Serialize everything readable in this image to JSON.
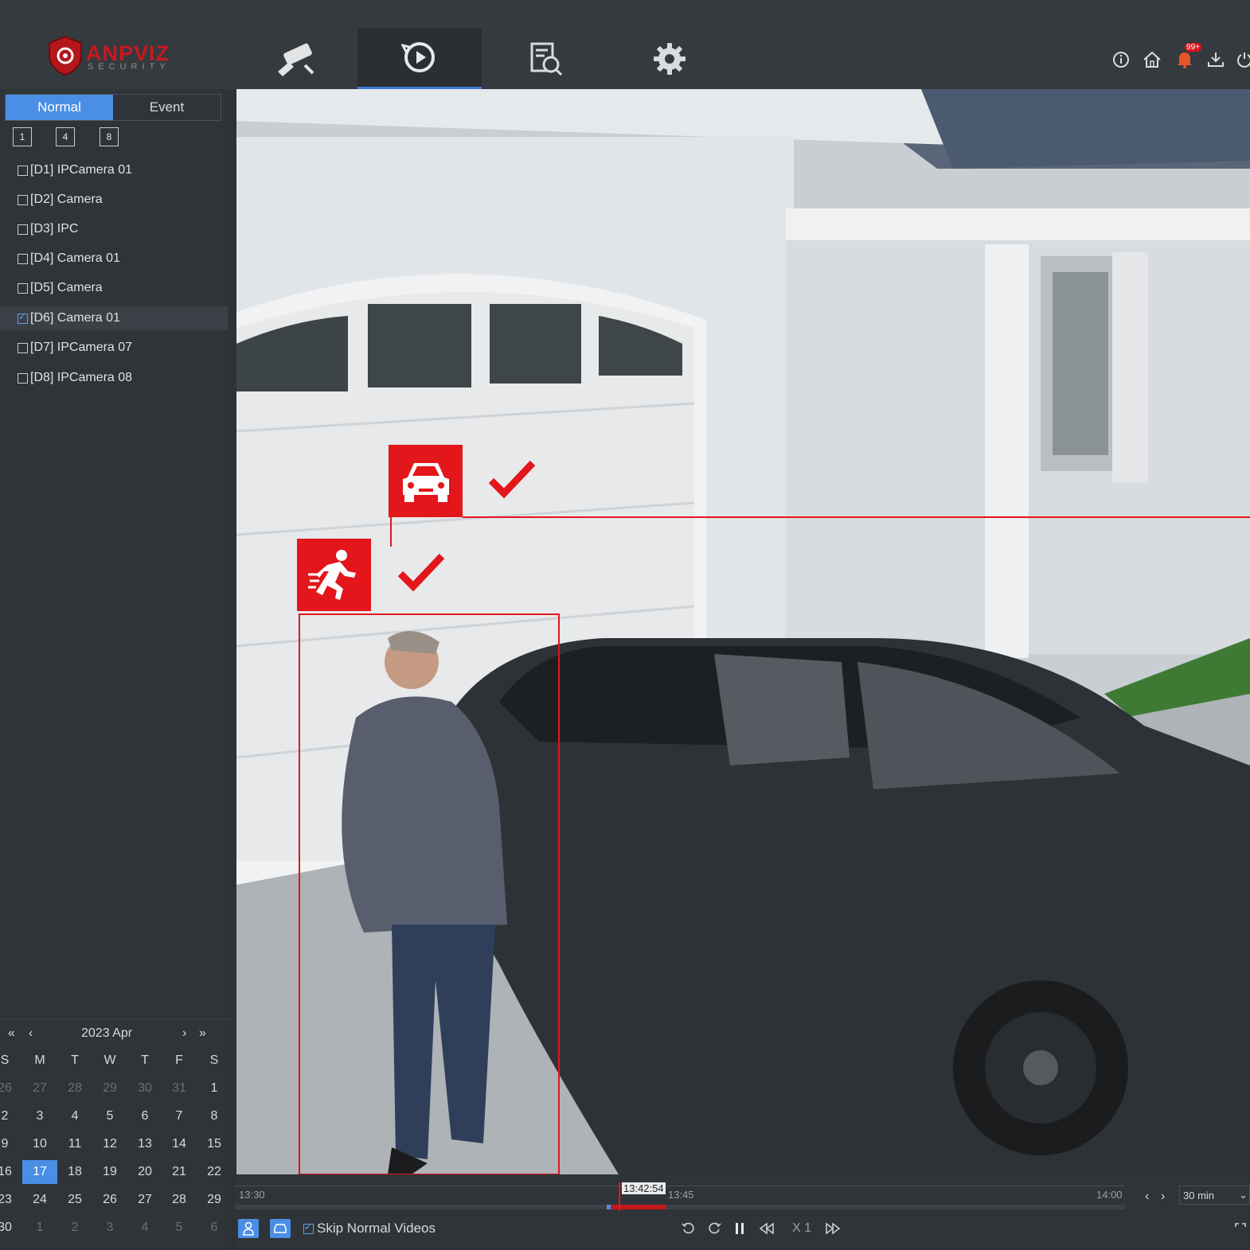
{
  "brand": {
    "name": "ANPVIZ",
    "tagline": "SECURITY",
    "color": "#c8191f"
  },
  "nav": [
    {
      "icon": "camera-icon",
      "active": false
    },
    {
      "icon": "playback-icon",
      "active": true
    },
    {
      "icon": "search-file-icon",
      "active": false
    },
    {
      "icon": "gear-icon",
      "active": false
    }
  ],
  "top_right": {
    "alert_badge": "99+"
  },
  "mode_tabs": {
    "normal": "Normal",
    "event": "Event"
  },
  "split_options": [
    "1",
    "4",
    "8"
  ],
  "cameras": [
    {
      "label": "[D1] IPCamera 01",
      "checked": false
    },
    {
      "label": "[D2] Camera",
      "checked": false
    },
    {
      "label": "[D3] IPC",
      "checked": false
    },
    {
      "label": "[D4] Camera 01",
      "checked": false
    },
    {
      "label": "[D5] Camera",
      "checked": false
    },
    {
      "label": "[D6] Camera 01",
      "checked": true
    },
    {
      "label": "[D7] IPCamera 07",
      "checked": false
    },
    {
      "label": "[D8] IPCamera 08",
      "checked": false
    }
  ],
  "calendar": {
    "title": "2023 Apr",
    "weekdays": [
      "S",
      "M",
      "T",
      "W",
      "T",
      "F",
      "S"
    ],
    "weeks": [
      [
        "26",
        "27",
        "28",
        "29",
        "30",
        "31",
        "1"
      ],
      [
        "2",
        "3",
        "4",
        "5",
        "6",
        "7",
        "8"
      ],
      [
        "9",
        "10",
        "11",
        "12",
        "13",
        "14",
        "15"
      ],
      [
        "16",
        "17",
        "18",
        "19",
        "20",
        "21",
        "22"
      ],
      [
        "23",
        "24",
        "25",
        "26",
        "27",
        "28",
        "29"
      ],
      [
        "30",
        "1",
        "2",
        "3",
        "4",
        "5",
        "6"
      ]
    ],
    "selected_day": "17"
  },
  "timeline": {
    "start": "13:30",
    "mid": "13:45",
    "end": "14:00",
    "cursor": "13:42:54",
    "zoom": "30 min"
  },
  "controls": {
    "skip_label": "Skip Normal Videos",
    "skip_checked": true,
    "speed": "X 1"
  },
  "detection": {
    "vehicle_checked": true,
    "human_checked": true,
    "accent": "#e3161b"
  }
}
